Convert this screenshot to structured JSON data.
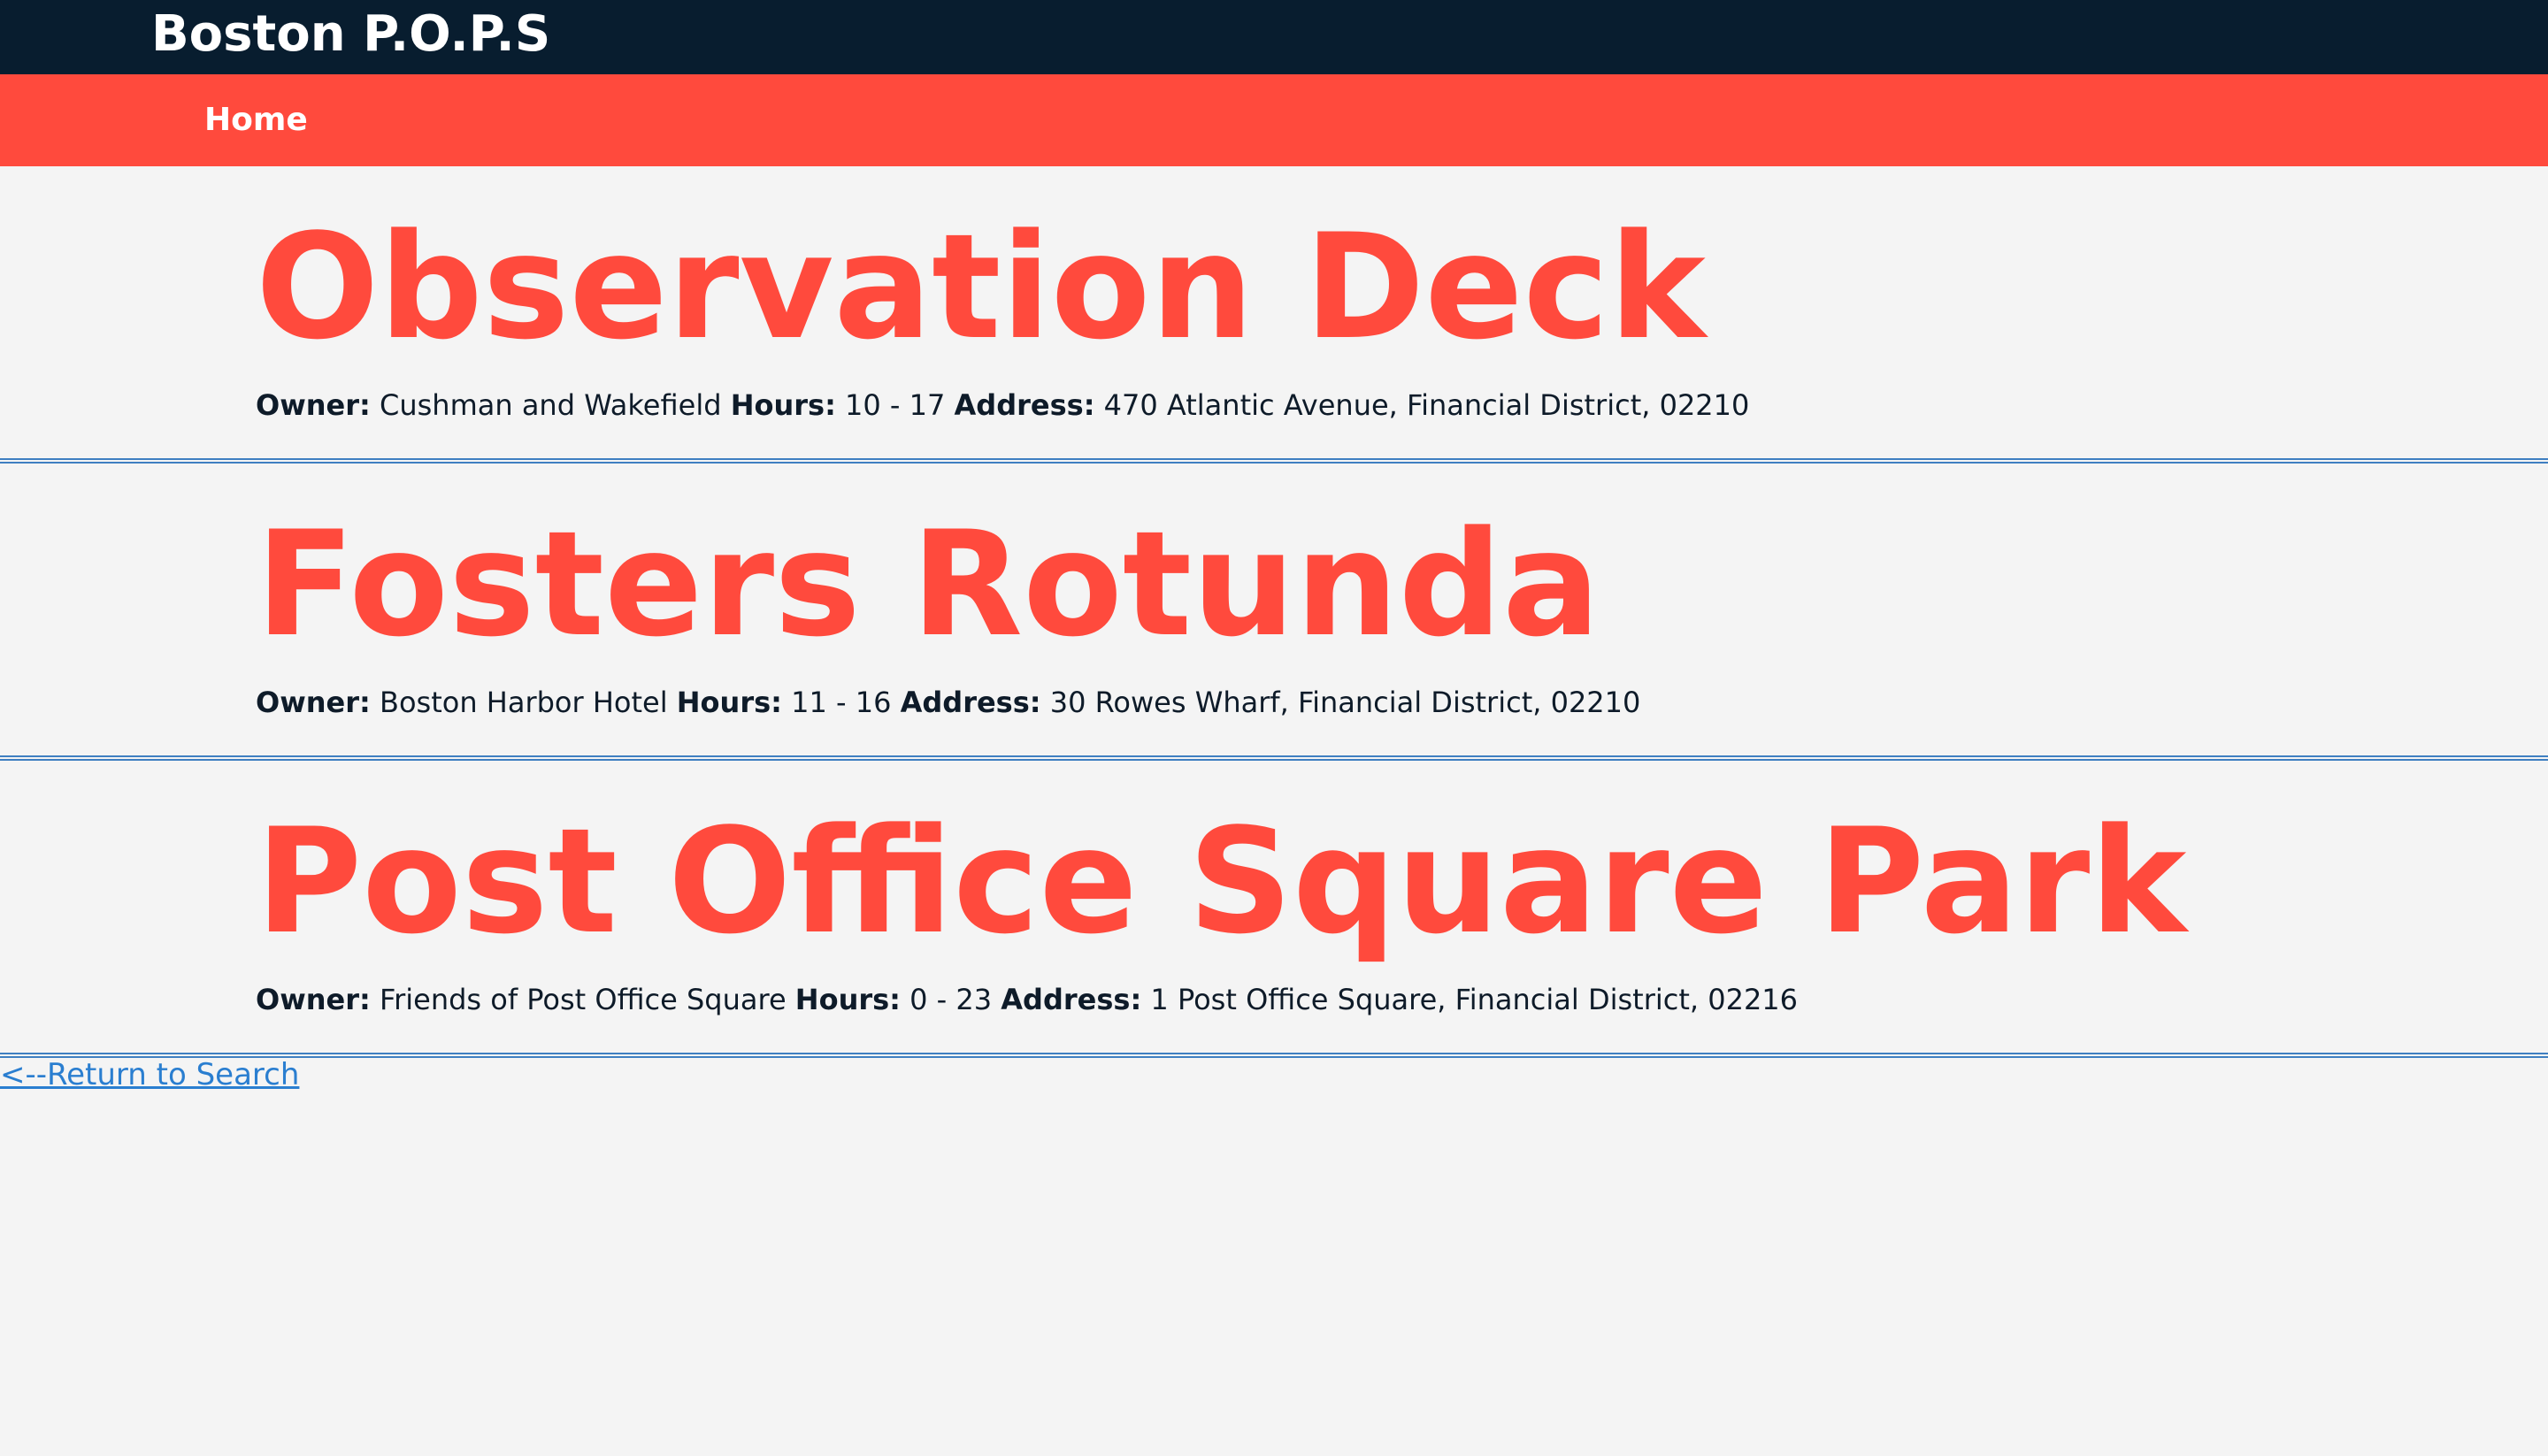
{
  "header": {
    "brand": "Boston P.O.P.S"
  },
  "nav": {
    "home_label": "Home"
  },
  "labels": {
    "owner": "Owner:",
    "hours": "Hours:",
    "address": "Address:"
  },
  "spots": [
    {
      "name": "Observation Deck",
      "owner": "Cushman and Wakefield",
      "hours": "10 - 17",
      "address": "470 Atlantic Avenue, Financial District, 02210"
    },
    {
      "name": "Fosters Rotunda",
      "owner": "Boston Harbor Hotel",
      "hours": "11 - 16",
      "address": "30 Rowes Wharf, Financial District, 02210"
    },
    {
      "name": "Post Office Square Park",
      "owner": "Friends of Post Office Square",
      "hours": "0 - 23",
      "address": "1 Post Office Square, Financial District, 02216"
    }
  ],
  "footer": {
    "return_label": "<--Return to Search"
  },
  "colors": {
    "topbar": "#081d2f",
    "navbar": "#ff4a3d",
    "accent": "#ff4a3d",
    "link": "#2a7ed0",
    "divider": "#3f7fc1"
  }
}
